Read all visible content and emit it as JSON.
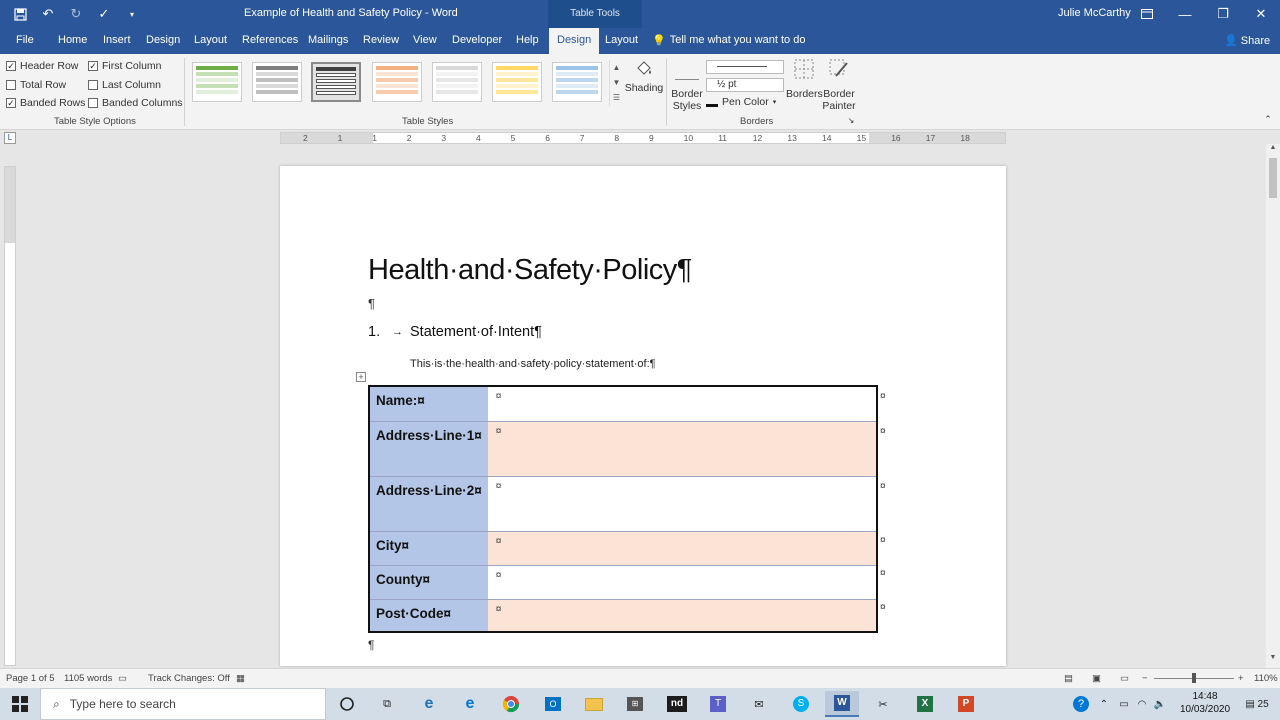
{
  "window": {
    "doc_title": "Example of Health and Safety Policy  -  Word",
    "context_tab": "Table Tools",
    "user": "Julie McCarthy"
  },
  "ribbon_tabs": [
    "File",
    "Home",
    "Insert",
    "Design",
    "Layout",
    "References",
    "Mailings",
    "Review",
    "View",
    "Developer",
    "Help",
    "Design",
    "Layout"
  ],
  "tell_me": "Tell me what you want to do",
  "share": "Share",
  "table_style_options": {
    "header_row": "Header Row",
    "total_row": "Total Row",
    "banded_rows": "Banded Rows",
    "first_column": "First Column",
    "last_column": "Last Column",
    "banded_columns": "Banded Columns",
    "group_label": "Table Style Options"
  },
  "table_styles_label": "Table Styles",
  "borders": {
    "shading": "Shading",
    "border_styles_1": "Border",
    "border_styles_2": "Styles",
    "line_weight": "½ pt",
    "pen_color": "Pen Color",
    "borders_btn": "Borders",
    "painter_1": "Border",
    "painter_2": "Painter",
    "group_label": "Borders"
  },
  "ruler_numbers": [
    "2",
    "1",
    "1",
    "2",
    "3",
    "4",
    "5",
    "6",
    "7",
    "8",
    "9",
    "10",
    "11",
    "12",
    "13",
    "14",
    "15",
    "16",
    "17",
    "18"
  ],
  "document": {
    "heading": "Health·and·Safety·Policy¶",
    "pilcrow": "¶",
    "list_number": "1.",
    "list_arrow": "→",
    "list_text": "Statement·of·Intent¶",
    "statement": "This·is·the·health·and·safety·policy·statement·of:¶",
    "table_rows": [
      {
        "label": "Name:¤",
        "value": "¤"
      },
      {
        "label": "Address·Line·1¤",
        "value": "¤"
      },
      {
        "label": "Address·Line·2¤",
        "value": "¤"
      },
      {
        "label": "City¤",
        "value": "¤"
      },
      {
        "label": "County¤",
        "value": "¤"
      },
      {
        "label": "Post·Code¤",
        "value": "¤"
      }
    ],
    "row_end_mark": "¤",
    "end_pilcrow": "¶"
  },
  "status": {
    "page": "Page 1 of 5",
    "words": "1105 words",
    "track_changes": "Track Changes: Off",
    "zoom": "110%"
  },
  "taskbar": {
    "search_placeholder": "Type here to search",
    "time": "14:48",
    "date": "10/03/2020"
  },
  "colors": {
    "word_blue": "#2b579a",
    "label_cell": "#b4c6e7",
    "banded_row": "#fbe4d5"
  }
}
